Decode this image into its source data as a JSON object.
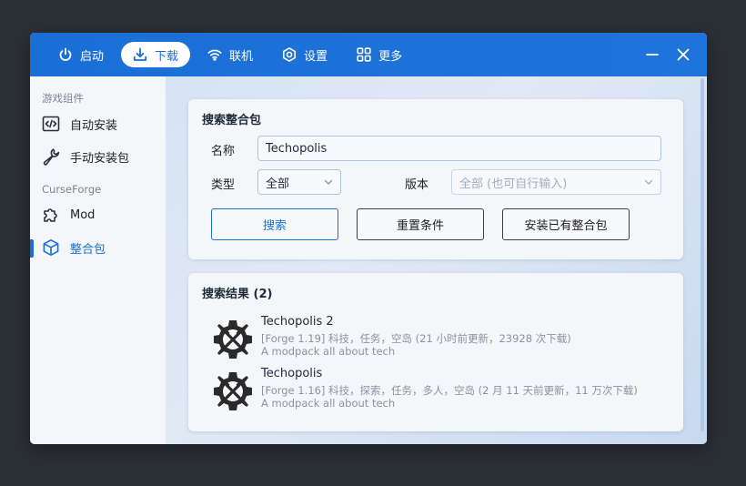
{
  "nav": {
    "items": [
      {
        "label": "启动",
        "icon": "power-icon"
      },
      {
        "label": "下载",
        "icon": "download-icon"
      },
      {
        "label": "联机",
        "icon": "wifi-icon"
      },
      {
        "label": "设置",
        "icon": "gear-icon"
      },
      {
        "label": "更多",
        "icon": "grid-icon"
      }
    ],
    "active_index": 1
  },
  "sidebar": {
    "section1": "游戏组件",
    "items1": [
      {
        "label": "自动安装",
        "icon": "code-icon"
      },
      {
        "label": "手动安装包",
        "icon": "wrench-icon"
      }
    ],
    "section2": "CurseForge",
    "items2": [
      {
        "label": "Mod",
        "icon": "puzzle-icon"
      },
      {
        "label": "整合包",
        "icon": "box-icon"
      }
    ]
  },
  "search": {
    "title": "搜索整合包",
    "name_label": "名称",
    "name_value": "Techopolis",
    "type_label": "类型",
    "type_value": "全部",
    "version_label": "版本",
    "version_placeholder": "全部 (也可自行输入)",
    "buttons": {
      "search": "搜索",
      "reset": "重置条件",
      "install": "安装已有整合包"
    }
  },
  "results": {
    "title": "搜索结果 (2)",
    "items": [
      {
        "name": "Techopolis 2",
        "meta": "[Forge 1.19] 科技，任务，空岛 (21 小时前更新，23928 次下载)",
        "desc": "A modpack all about tech"
      },
      {
        "name": "Techopolis",
        "meta": "[Forge 1.16] 科技，探索，任务，多人，空岛 (2 月 11 天前更新，11 万次下载)",
        "desc": "A modpack all about tech"
      }
    ]
  },
  "colors": {
    "accent": "#1a6fd6",
    "background": "#2b2f36"
  }
}
